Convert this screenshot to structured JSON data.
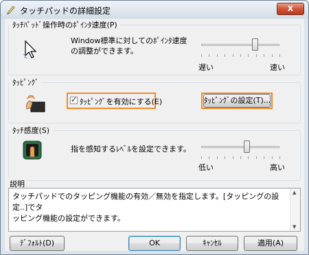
{
  "window": {
    "title": "タッチパッドの詳細設定",
    "close_glyph": "x"
  },
  "pointer_speed": {
    "group_label": "ﾀｯﾁﾊﾟｯﾄﾞ操作時のﾎﾟｲﾝﾀ速度(P)",
    "description_line1": "Window標準に対してのﾎﾟｲﾝﾀ速度",
    "description_line2": "の調整ができます。",
    "slow_label": "遅い",
    "fast_label": "速い",
    "slider_value_fraction": 0.68
  },
  "tapping": {
    "group_label": "ﾀｯﾋﾟﾝｸﾞ",
    "enable_checkbox_label": "ﾀｯﾋﾟﾝｸﾞを有効にする(E)",
    "enable_checked": true,
    "settings_button_label": "ﾀｯﾋﾟﾝｸﾞの設定(T)..."
  },
  "sensitivity": {
    "group_label": "ﾀｯﾁ感度(S)",
    "description": "指を感知するﾚﾍﾞﾙを設定できます。",
    "low_label": "低い",
    "high_label": "高い",
    "slider_value_fraction": 0.58
  },
  "explanation": {
    "group_label": "説明",
    "text_line1": "タッチパッドでのタッピング機能の有効／無効を指定します。[タッピングの設定..]でタ",
    "text_line2": "ッピング機能の設定ができます。"
  },
  "buttons": {
    "default_label": "ﾃﾞﾌｫﾙﾄ(D)",
    "ok_label": "OK",
    "cancel_label": "ｷｬﾝｾﾙ",
    "apply_label": "適用(A)"
  },
  "colors": {
    "highlight": "#f08a24",
    "close_button": "#c9452a"
  }
}
